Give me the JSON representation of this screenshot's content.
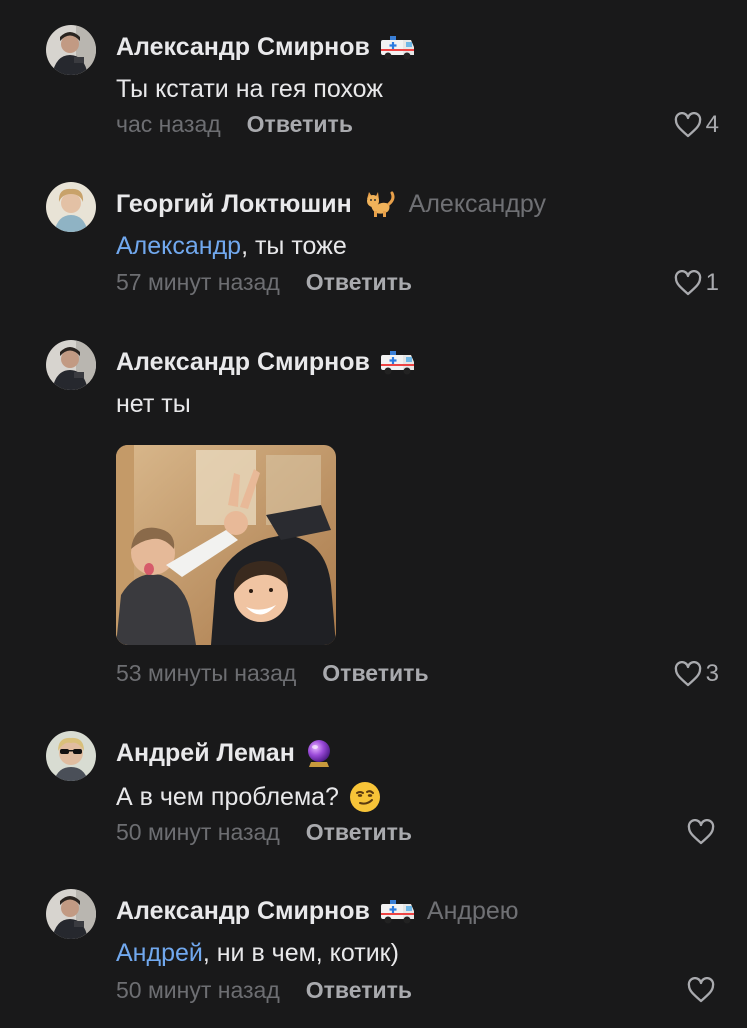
{
  "comments": [
    {
      "author": "Александр Смирнов",
      "author_emoji": "ambulance-icon",
      "text": "Ты кстати на гея похож",
      "time": "час назад",
      "reply_label": "Ответить",
      "likes": "4"
    },
    {
      "author": "Георгий Локтюшин",
      "author_emoji": "cat-icon",
      "reply_to": "Александру",
      "mention": "Александр",
      "text": ", ты тоже",
      "time": "57 минут назад",
      "reply_label": "Ответить",
      "likes": "1"
    },
    {
      "author": "Александр Смирнов",
      "author_emoji": "ambulance-icon",
      "text": "нет ты",
      "attachment": "photo-two-boys-making-horns-gesture",
      "time": "53 минуты назад",
      "reply_label": "Ответить",
      "likes": "3"
    },
    {
      "author": "Андрей Леман",
      "author_emoji": "crystal-ball-icon",
      "text": "А в чем проблема?",
      "text_emoji": "smirking-face-icon",
      "time": "50 минут назад",
      "reply_label": "Ответить",
      "likes": ""
    },
    {
      "author": "Александр Смирнов",
      "author_emoji": "ambulance-icon",
      "reply_to": "Андрею",
      "mention": "Андрей",
      "text": ", ни в чем, котик)",
      "time": "50 минут назад",
      "reply_label": "Ответить",
      "likes": ""
    }
  ],
  "colors": {
    "background": "#19191a",
    "text": "#e8e8ea",
    "muted": "#6d6e72",
    "mention": "#71a8ee",
    "action": "#a9aaae"
  }
}
